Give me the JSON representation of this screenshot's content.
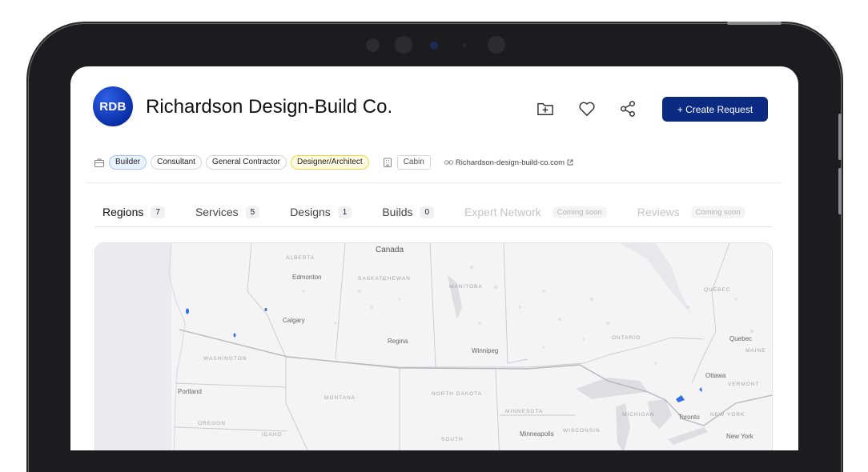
{
  "company": {
    "initials": "RDB",
    "name": "Richardson Design-Build Co."
  },
  "header_actions": {
    "create_label": "+ Create Request",
    "icons": [
      "folder-plus-icon",
      "heart-icon",
      "share-icon"
    ]
  },
  "roles": [
    {
      "label": "Builder",
      "style": "blue"
    },
    {
      "label": "Consultant",
      "style": "plain"
    },
    {
      "label": "General Contractor",
      "style": "plain"
    },
    {
      "label": "Designer/Architect",
      "style": "yellow"
    }
  ],
  "style_tag": "Cabin",
  "website": "Richardson-design-build-co.com",
  "tabs": [
    {
      "label": "Regions",
      "count": "7",
      "state": "active"
    },
    {
      "label": "Services",
      "count": "5",
      "state": "normal"
    },
    {
      "label": "Designs",
      "count": "1",
      "state": "normal"
    },
    {
      "label": "Builds",
      "count": "0",
      "state": "normal"
    },
    {
      "label": "Expert Network",
      "badge": "Coming soon",
      "state": "disabled"
    },
    {
      "label": "Reviews",
      "badge": "Coming soon",
      "state": "disabled"
    }
  ],
  "map": {
    "country": "Canada",
    "regions": [
      "ALBERTA",
      "SASKATCHEWAN",
      "MANITOBA",
      "QUÉBEC",
      "ONTARIO",
      "WASHINGTON",
      "MONTANA",
      "NORTH DAKOTA",
      "MINNESOTA",
      "OREGON",
      "IDAHO",
      "SOUTH",
      "MICHIGAN",
      "WISCONSIN",
      "NEW YORK",
      "VERMONT",
      "MAINE"
    ],
    "cities": [
      "Edmonton",
      "Calgary",
      "Regina",
      "Winnipeg",
      "Portland",
      "Ottawa",
      "Quebec",
      "Toronto",
      "Minneapolis",
      "New York"
    ],
    "marker_color": "#2f6fe8"
  },
  "colors": {
    "primary": "#0b2a82",
    "tag_blue_bg": "#e9f1ff",
    "tag_yellow_border": "#f1d54a"
  }
}
